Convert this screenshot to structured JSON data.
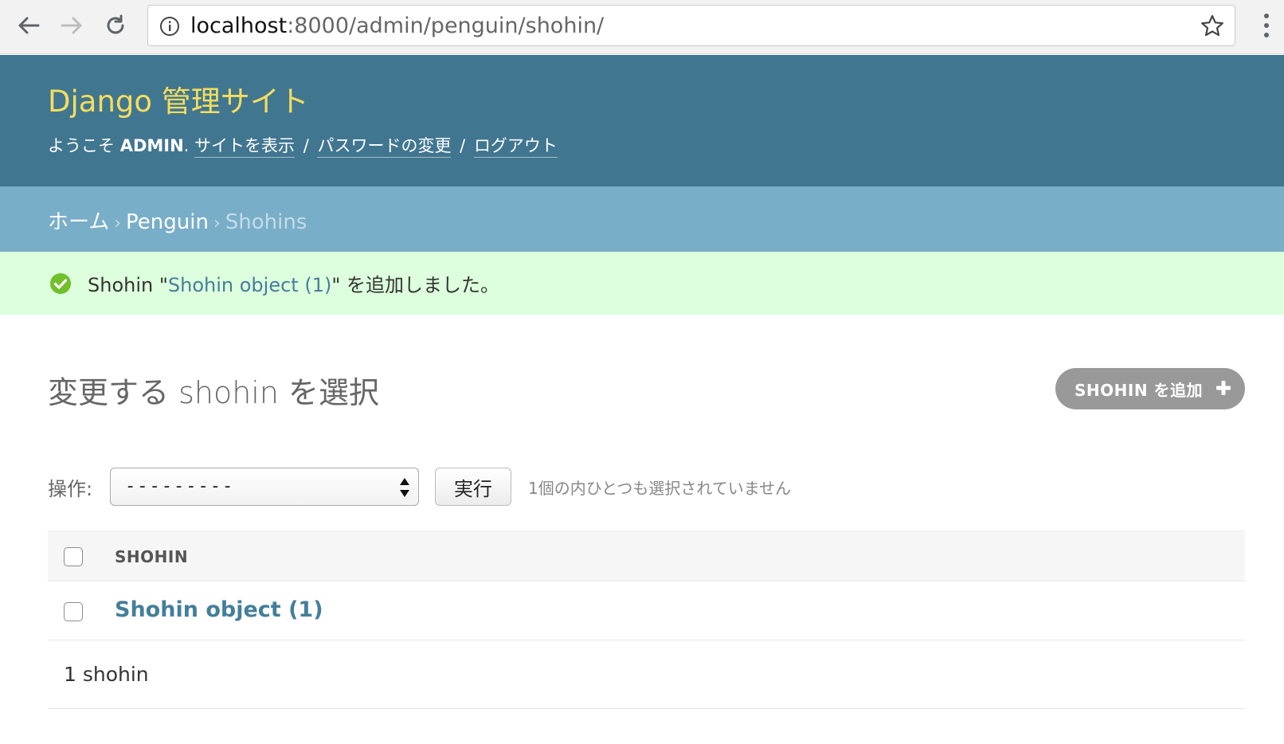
{
  "browser": {
    "url_host": "localhost",
    "url_rest": ":8000/admin/penguin/shohin/"
  },
  "header": {
    "site_name": "Django 管理サイト",
    "welcome": "ようこそ ",
    "username": "ADMIN",
    "view_site": "サイトを表示",
    "change_password": "パスワードの変更",
    "logout": "ログアウト",
    "separator": "/"
  },
  "breadcrumbs": {
    "home": "ホーム",
    "app": "Penguin",
    "current": "Shohins",
    "arrow": "›"
  },
  "message": {
    "prefix": "Shohin \"",
    "object_link": "Shohin object (1)",
    "suffix": "\" を追加しました。"
  },
  "content": {
    "title": "変更する shohin を選択",
    "add_button": "SHOHIN を追加",
    "actions_label": "操作:",
    "action_selected": "---------",
    "go_button": "実行",
    "action_counter": "1個の内ひとつも選択されていません",
    "column_header": "SHOHIN",
    "rows": [
      {
        "label": "Shohin object (1)"
      }
    ],
    "paginator": "1 shohin"
  },
  "colors": {
    "header_bg": "#417690",
    "branding": "#f5dd5d",
    "breadcrumbs_bg": "#79aec8",
    "success_bg": "#ddffdd",
    "link": "#447e9b"
  }
}
